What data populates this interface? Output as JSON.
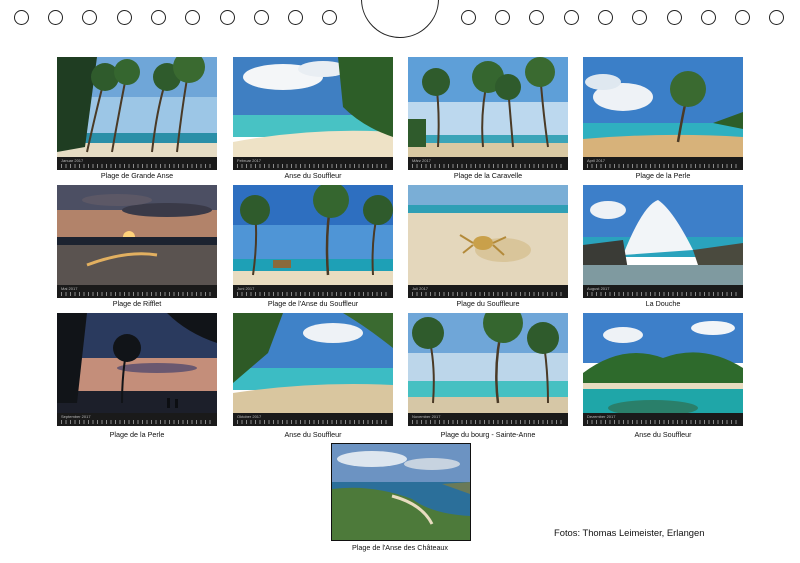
{
  "photos": [
    {
      "caption": "Plage de Grande Anse",
      "month": "Januar 2017"
    },
    {
      "caption": "Anse du Souffleur",
      "month": "Februar 2017"
    },
    {
      "caption": "Plage de la Caravelle",
      "month": "März 2017"
    },
    {
      "caption": "Plage de la Perle",
      "month": "April 2017"
    },
    {
      "caption": "Plage de Rifflet",
      "month": "Mai 2017"
    },
    {
      "caption": "Plage de l'Anse du Souffleur",
      "month": "Juni 2017"
    },
    {
      "caption": "Plage du Souffleure",
      "month": "Juli 2017"
    },
    {
      "caption": "La Douche",
      "month": "August 2017"
    },
    {
      "caption": "Plage de la Perle",
      "month": "September 2017"
    },
    {
      "caption": "Anse du Souffleur",
      "month": "Oktober 2017"
    },
    {
      "caption": "Plage du bourg - Sainte-Anne",
      "month": "November 2017"
    },
    {
      "caption": "Anse du Souffleur",
      "month": "Dezember 2017"
    }
  ],
  "cover": {
    "caption": "Plage de l'Anse des Châteaux"
  },
  "credit": "Fotos: Thomas Leimeister, Erlangen"
}
